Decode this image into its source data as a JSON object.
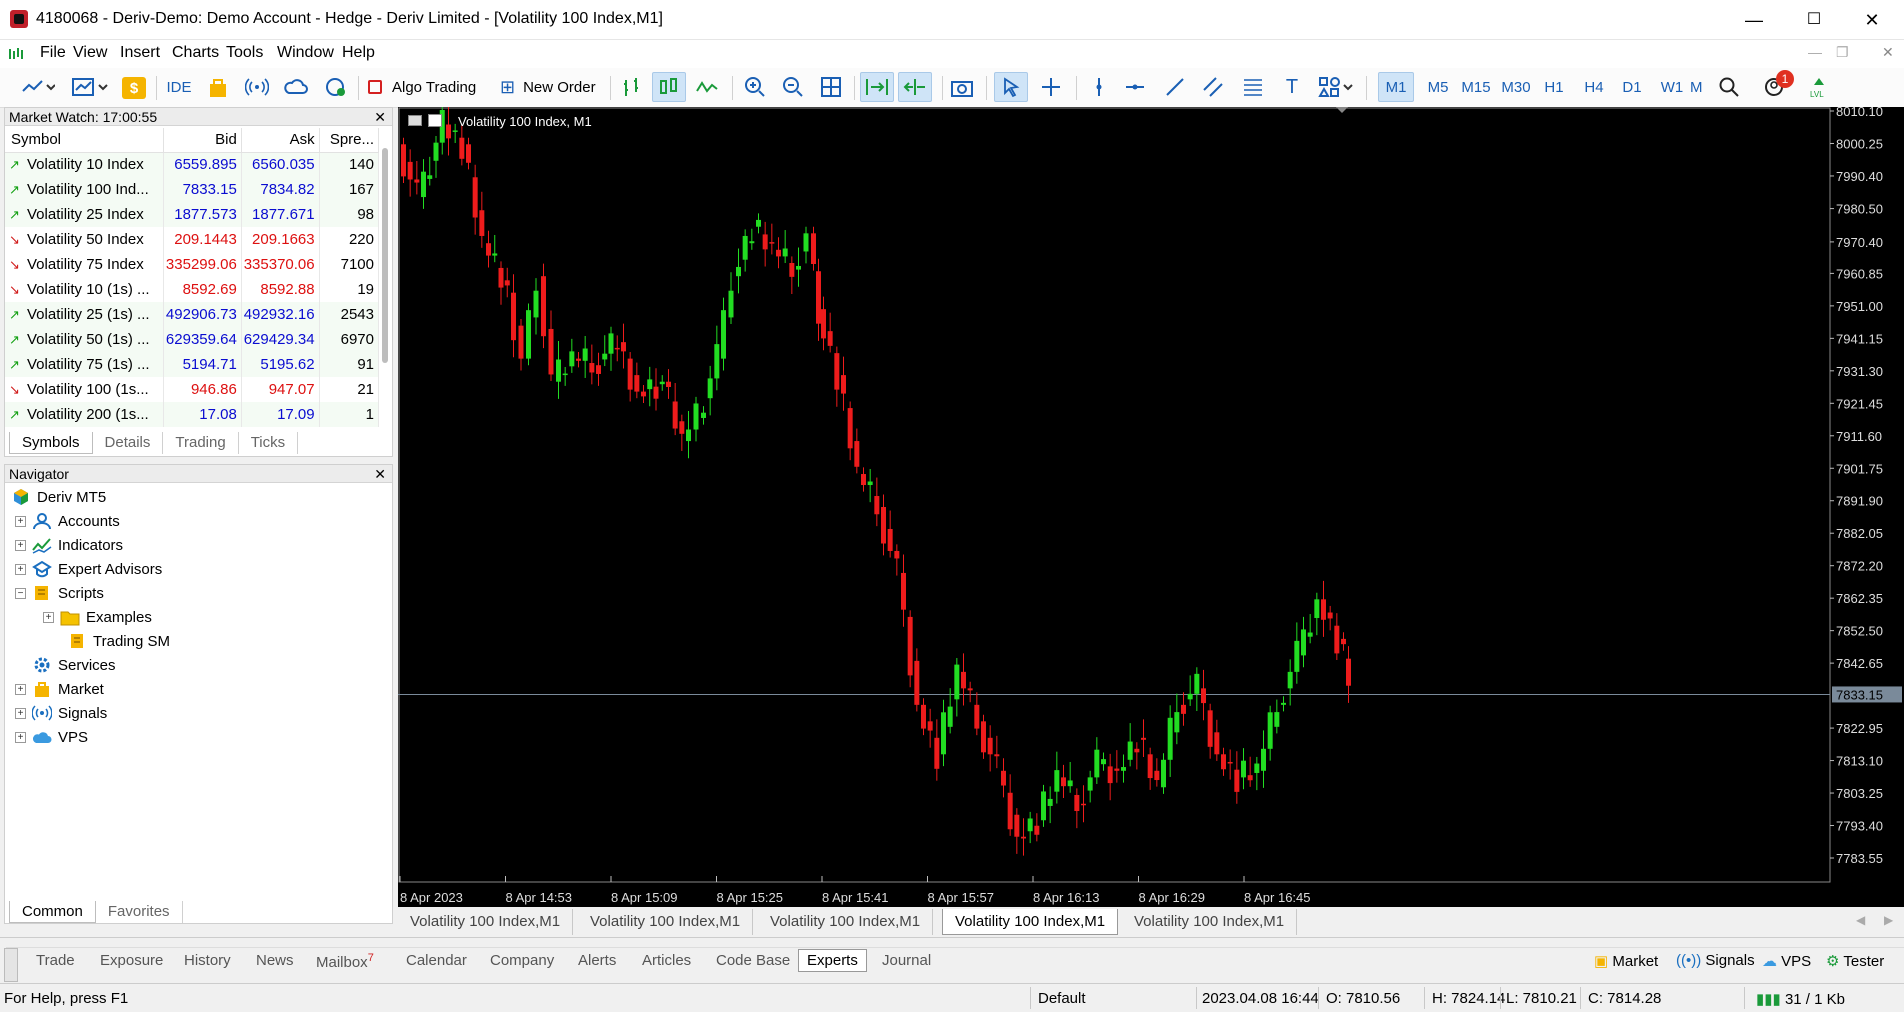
{
  "window": {
    "title": "4180068 - Deriv-Demo: Demo Account - Hedge - Deriv Limited - [Volatility 100 Index,M1]"
  },
  "menu": [
    "File",
    "View",
    "Insert",
    "Charts",
    "Tools",
    "Window",
    "Help"
  ],
  "toolbar": {
    "ide": "IDE",
    "algo": "Algo Trading",
    "new_order": "New Order",
    "timeframes": [
      "M1",
      "M5",
      "M15",
      "M30",
      "H1",
      "H4",
      "D1",
      "W1",
      "M"
    ],
    "active_tf": "M1",
    "notif_count": "1"
  },
  "market_watch": {
    "title": "Market Watch: 17:00:55",
    "columns": [
      "Symbol",
      "Bid",
      "Ask",
      "Spre..."
    ],
    "rows": [
      {
        "symbol": "Volatility 10 Index",
        "bid": "6559.895",
        "ask": "6560.035",
        "spread": "140",
        "dir": "up"
      },
      {
        "symbol": "Volatility 100 Ind...",
        "bid": "7833.15",
        "ask": "7834.82",
        "spread": "167",
        "dir": "up"
      },
      {
        "symbol": "Volatility 25 Index",
        "bid": "1877.573",
        "ask": "1877.671",
        "spread": "98",
        "dir": "up"
      },
      {
        "symbol": "Volatility 50 Index",
        "bid": "209.1443",
        "ask": "209.1663",
        "spread": "220",
        "dir": "down"
      },
      {
        "symbol": "Volatility 75 Index",
        "bid": "335299.06",
        "ask": "335370.06",
        "spread": "7100",
        "dir": "down"
      },
      {
        "symbol": "Volatility 10 (1s) ...",
        "bid": "8592.69",
        "ask": "8592.88",
        "spread": "19",
        "dir": "down"
      },
      {
        "symbol": "Volatility 25 (1s) ...",
        "bid": "492906.73",
        "ask": "492932.16",
        "spread": "2543",
        "dir": "up"
      },
      {
        "symbol": "Volatility 50 (1s) ...",
        "bid": "629359.64",
        "ask": "629429.34",
        "spread": "6970",
        "dir": "up"
      },
      {
        "symbol": "Volatility 75 (1s) ...",
        "bid": "5194.71",
        "ask": "5195.62",
        "spread": "91",
        "dir": "up"
      },
      {
        "symbol": "Volatility 100 (1s...",
        "bid": "946.86",
        "ask": "947.07",
        "spread": "21",
        "dir": "down"
      },
      {
        "symbol": "Volatility 200 (1s...",
        "bid": "17.08",
        "ask": "17.09",
        "spread": "1",
        "dir": "up"
      }
    ],
    "tabs": [
      "Symbols",
      "Details",
      "Trading",
      "Ticks"
    ]
  },
  "navigator": {
    "title": "Navigator",
    "root": "Deriv MT5",
    "items": [
      "Accounts",
      "Indicators",
      "Expert Advisors",
      "Scripts",
      "Examples",
      "Trading SM",
      "Services",
      "Market",
      "Signals",
      "VPS"
    ],
    "tabs": [
      "Common",
      "Favorites"
    ]
  },
  "chart": {
    "label": "Volatility 100 Index, M1",
    "current_price": "7833.15",
    "y_ticks": [
      "8010.10",
      "8000.25",
      "7990.40",
      "7980.50",
      "7970.40",
      "7960.85",
      "7951.00",
      "7941.15",
      "7931.30",
      "7921.45",
      "7911.60",
      "7901.75",
      "7891.90",
      "7882.05",
      "7872.20",
      "7862.35",
      "7852.50",
      "7842.65",
      "7833.15",
      "7822.95",
      "7813.10",
      "7803.25",
      "7793.40",
      "7783.55"
    ],
    "x_ticks": [
      "8 Apr 2023",
      "8 Apr 14:53",
      "8 Apr 15:09",
      "8 Apr 15:25",
      "8 Apr 15:41",
      "8 Apr 15:57",
      "8 Apr 16:13",
      "8 Apr 16:29",
      "8 Apr 16:45"
    ]
  },
  "chart_tabs": [
    "Volatility 100 Index,M1",
    "Volatility 100 Index,M1",
    "Volatility 100 Index,M1",
    "Volatility 100 Index,M1",
    "Volatility 100 Index,M1"
  ],
  "toolbox": {
    "tabs": [
      "Trade",
      "Exposure",
      "History",
      "News",
      "Mailbox",
      "Calendar",
      "Company",
      "Alerts",
      "Articles",
      "Code Base",
      "Experts",
      "Journal"
    ],
    "mailbox_count": "7",
    "right": [
      "Market",
      "Signals",
      "VPS",
      "Tester"
    ]
  },
  "status": {
    "help": "For Help, press F1",
    "profile": "Default",
    "time": "2023.04.08 16:44",
    "open": "O: 7810.56",
    "high": "H: 7824.14",
    "low": "L: 7810.21",
    "close": "C: 7814.28",
    "traffic": "31 / 1 Kb"
  }
}
